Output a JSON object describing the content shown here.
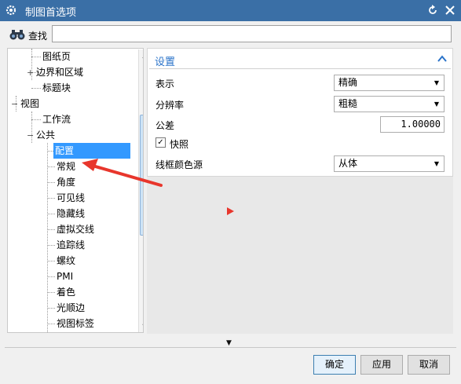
{
  "window": {
    "title": "制图首选项"
  },
  "search": {
    "label": "查找",
    "value": ""
  },
  "tree": {
    "items": [
      {
        "label": "图纸页"
      },
      {
        "label": "边界和区域",
        "expander": "+"
      },
      {
        "label": "标题块"
      },
      {
        "label": "视图",
        "expander": "−"
      },
      {
        "label": "工作流"
      },
      {
        "label": "公共",
        "expander": "−"
      },
      {
        "label": "配置",
        "selected": true
      },
      {
        "label": "常规"
      },
      {
        "label": "角度"
      },
      {
        "label": "可见线"
      },
      {
        "label": "隐藏线"
      },
      {
        "label": "虚拟交线"
      },
      {
        "label": "追踪线"
      },
      {
        "label": "螺纹"
      },
      {
        "label": "PMI"
      },
      {
        "label": "着色"
      },
      {
        "label": "光顺边"
      },
      {
        "label": "视图标签"
      }
    ]
  },
  "settings": {
    "title": "设置",
    "display": {
      "label": "表示",
      "value": "精确"
    },
    "resolution": {
      "label": "分辨率",
      "value": "粗糙"
    },
    "tolerance": {
      "label": "公差",
      "value": "1.00000"
    },
    "snapshot": {
      "label": "快照",
      "checked": true
    },
    "wire_color": {
      "label": "线框颜色源",
      "value": "从体"
    }
  },
  "buttons": {
    "ok": "确定",
    "apply": "应用",
    "cancel": "取消"
  },
  "colors": {
    "titlebar": "#3a6fa6",
    "accent": "#2a73c9",
    "selection": "#3399ff",
    "annotation": "#e8362c"
  }
}
